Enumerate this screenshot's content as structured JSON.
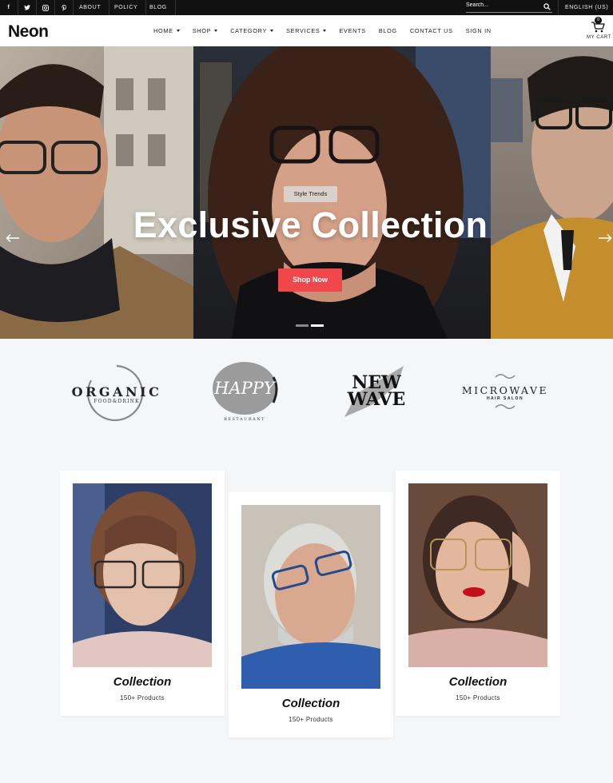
{
  "topbar": {
    "social": [
      "f",
      "t",
      "ig",
      "p"
    ],
    "links": [
      "ABOUT",
      "POLICY",
      "BLOG"
    ],
    "search_placeholder": "Search...",
    "language": "ENGLISH (US)"
  },
  "header": {
    "logo": "Neon",
    "nav": [
      {
        "label": "HOME",
        "dropdown": true
      },
      {
        "label": "SHOP",
        "dropdown": true
      },
      {
        "label": "CATEGORY",
        "dropdown": true
      },
      {
        "label": "SERVICES",
        "dropdown": true
      },
      {
        "label": "EVENTS",
        "dropdown": false
      },
      {
        "label": "BLOG",
        "dropdown": false
      },
      {
        "label": "CONTACT US",
        "dropdown": false
      },
      {
        "label": "SIGN IN",
        "dropdown": false
      }
    ],
    "cart_count": "0",
    "cart_label": "MY CART"
  },
  "hero": {
    "tag": "Style Trends",
    "headline": "Exclusive Collection",
    "cta": "Shop Now",
    "slides_total": 2,
    "slide_active": 2
  },
  "brands": [
    {
      "name": "ORGANIC",
      "sub": "FOOD&DRINK"
    },
    {
      "name": "HAPPY",
      "sub": "RESTAURANT"
    },
    {
      "name": "NEW",
      "name2": "WAVE"
    },
    {
      "name": "MICROWAVE",
      "sub": "HAIR SALON"
    }
  ],
  "collections": [
    {
      "title": "Collection",
      "count": "150+ Products"
    },
    {
      "title": "Collection",
      "count": "150+ Products"
    },
    {
      "title": "Collection",
      "count": "150+ Products"
    }
  ],
  "colors": {
    "accent": "#f0474c",
    "topbar": "#111111",
    "page_bg": "#f5f6f8"
  }
}
